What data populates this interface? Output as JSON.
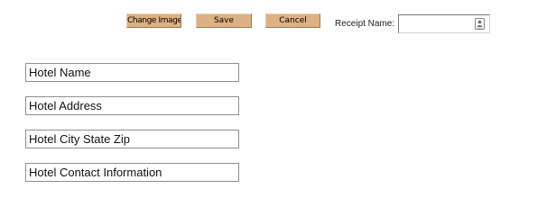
{
  "toolbar": {
    "change_image_label": "Change Image",
    "save_label": "Save",
    "cancel_label": "Cancel"
  },
  "receipt": {
    "label": "Receipt Name:",
    "value": "",
    "icon": "contact-card-icon"
  },
  "hotel": {
    "name": "Hotel Name",
    "address": "Hotel Address",
    "city_state_zip": "Hotel City State Zip",
    "contact_info": "Hotel Contact Information"
  },
  "colors": {
    "button_bg": "#deb183",
    "field_border": "#8f8f8f"
  }
}
